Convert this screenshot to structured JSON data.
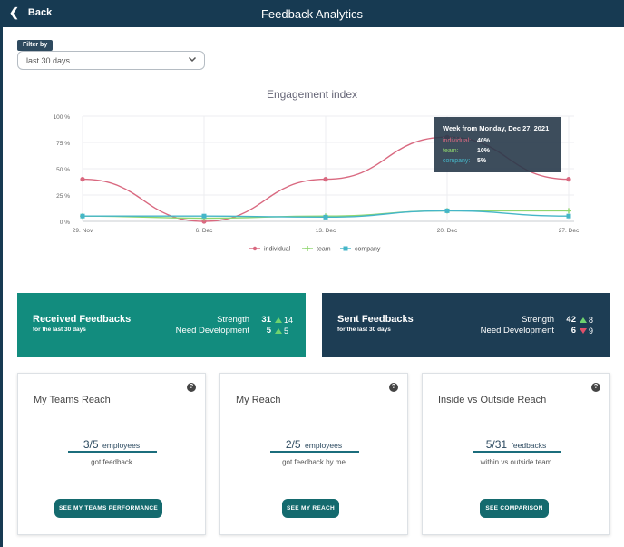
{
  "header": {
    "back_label": "Back",
    "title": "Feedback Analytics"
  },
  "filter": {
    "tag": "Filter by",
    "selected": "last 30 days"
  },
  "chart_data": {
    "type": "line",
    "title": "Engagement index",
    "categories": [
      "29. Nov",
      "6. Dec",
      "13. Dec",
      "20. Dec",
      "27. Dec"
    ],
    "y_ticks": [
      "0 %",
      "25 %",
      "50 %",
      "75 %",
      "100 %"
    ],
    "ylim": [
      0,
      100
    ],
    "grid": true,
    "legend_position": "bottom",
    "series": [
      {
        "name": "individual",
        "color": "#d96980",
        "values": [
          40,
          0,
          40,
          80,
          40
        ]
      },
      {
        "name": "team",
        "color": "#8fd66e",
        "values": [
          5,
          3,
          5,
          10,
          10
        ]
      },
      {
        "name": "company",
        "color": "#45b6c8",
        "values": [
          5,
          5,
          4,
          10,
          5
        ]
      }
    ],
    "tooltip": {
      "title": "Week from Monday, Dec 27, 2021",
      "rows": [
        {
          "name": "individual:",
          "value": "40%"
        },
        {
          "name": "team:",
          "value": "10%"
        },
        {
          "name": "company:",
          "value": "5%"
        }
      ]
    }
  },
  "received": {
    "title": "Received Feedbacks",
    "subtitle": "for the last 30 days",
    "strength_label": "Strength",
    "strength_value": "31",
    "strength_delta": "14",
    "need_label": "Need Development",
    "need_value": "5",
    "need_delta": "5"
  },
  "sent": {
    "title": "Sent Feedbacks",
    "subtitle": "for the last 30 days",
    "strength_label": "Strength",
    "strength_value": "42",
    "strength_delta": "8",
    "need_label": "Need Development",
    "need_value": "6",
    "need_delta": "9"
  },
  "cards": [
    {
      "title": "My Teams Reach",
      "value": "3/5",
      "unit": "employees",
      "caption": "got feedback",
      "button": "SEE MY TEAMS PERFORMANCE"
    },
    {
      "title": "My Reach",
      "value": "2/5",
      "unit": "employees",
      "caption": "got feedback by me",
      "button": "SEE MY REACH"
    },
    {
      "title": "Inside vs Outside Reach",
      "value": "5/31",
      "unit": "feedbacks",
      "caption": "within vs outside team",
      "button": "SEE COMPARISON"
    }
  ],
  "icons": {
    "help": "help-icon",
    "back": "chevron-left-icon",
    "dropdown": "chevron-down-icon"
  }
}
